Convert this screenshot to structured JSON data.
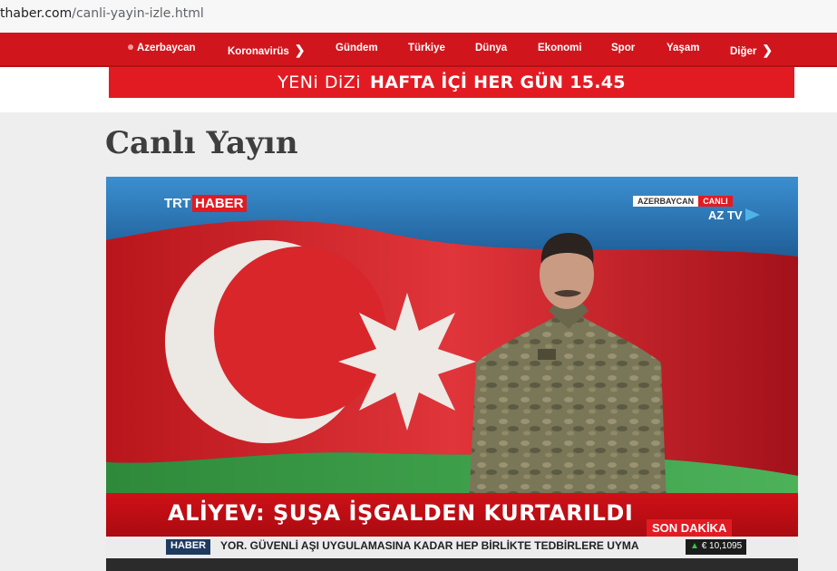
{
  "browser": {
    "url_host": "thaber.com",
    "url_path": "/canli-yayin-izle.html"
  },
  "nav": {
    "items": [
      {
        "label": "Azerbaycan",
        "dot": true
      },
      {
        "label": "Koronavirüs",
        "chevron": true
      },
      {
        "label": "Gündem"
      },
      {
        "label": "Türkiye"
      },
      {
        "label": "Dünya"
      },
      {
        "label": "Ekonomi"
      },
      {
        "label": "Spor"
      },
      {
        "label": "Yaşam"
      },
      {
        "label": "Diğer",
        "chevron": true
      }
    ],
    "chevron_glyph": "❯"
  },
  "banner": {
    "part1": "YENi DiZi",
    "part2": "HAFTA İÇİ HER GÜN 15.45"
  },
  "page": {
    "title": "Canlı Yayın"
  },
  "player": {
    "logo_trt": "TRT",
    "logo_haber": "HABER",
    "live_country": "AZERBAYCAN",
    "live_label": "CANLI",
    "channel": "AZ TV",
    "headline": "ALİYEV: ŞUŞA İŞGALDEN KURTARILDI",
    "breaking": "SON DAKİKA",
    "ticker_label": "HABER",
    "ticker_text": "YOR. GÜVENLİ AŞI UYGULAMASINA KADAR HEP BİRLİKTE TEDBİRLERE UYMA",
    "fx_text": "€ 10,1095",
    "fx_arrow": "▲"
  },
  "colors": {
    "brand_red": "#d0161c",
    "flag_blue": "#2f7fc1",
    "flag_red": "#d8262b",
    "flag_green": "#2f9a3e"
  }
}
